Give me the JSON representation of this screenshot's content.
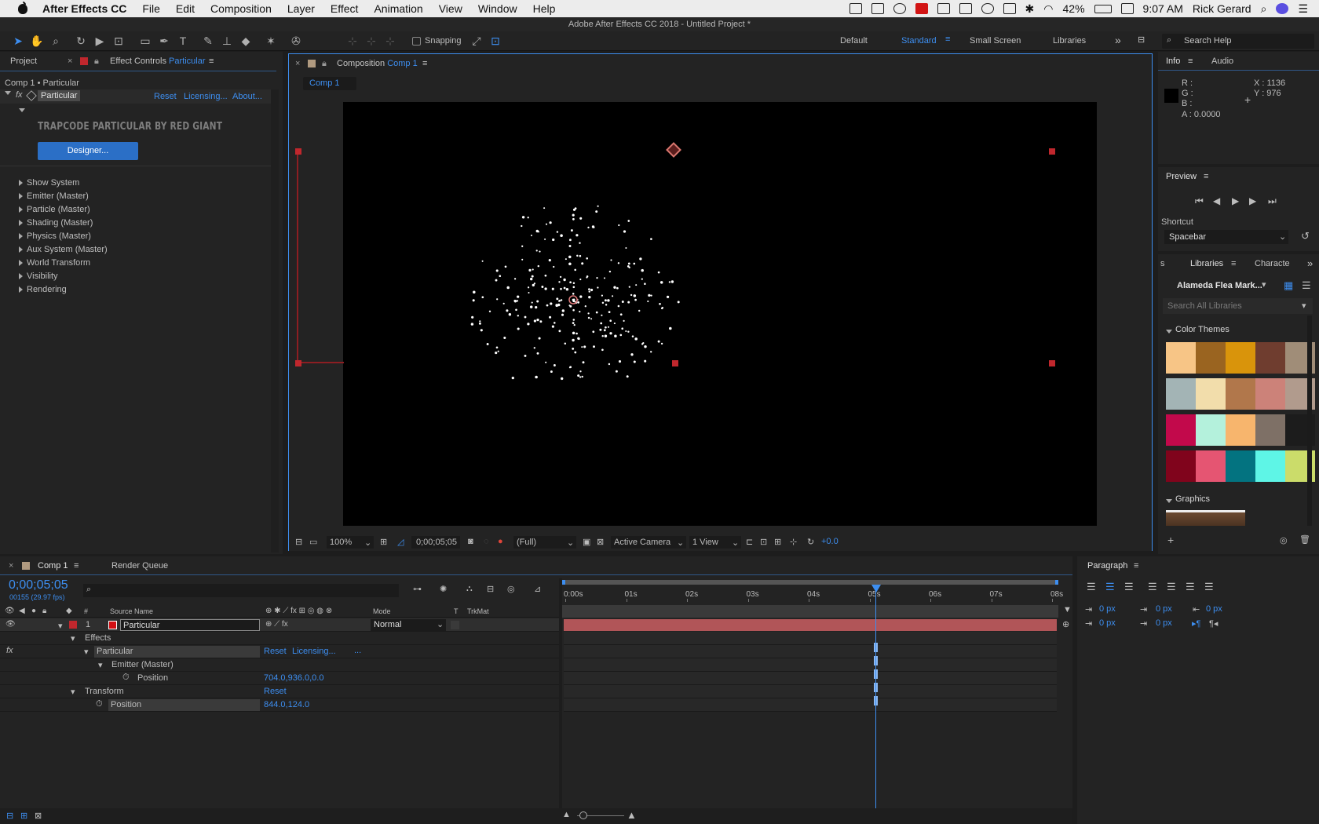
{
  "macbar": {
    "app": "After Effects CC",
    "menus": [
      "File",
      "Edit",
      "Composition",
      "Layer",
      "Effect",
      "Animation",
      "View",
      "Window",
      "Help"
    ],
    "battery": "42%",
    "time": "9:07 AM",
    "user": "Rick Gerard"
  },
  "window_title": "Adobe After Effects CC 2018 - Untitled Project *",
  "toolbar": {
    "snapping": "Snapping",
    "workspaces": [
      "Default",
      "Standard",
      "Small Screen",
      "Libraries"
    ],
    "active_workspace": "Standard",
    "search": "Search Help"
  },
  "left_panel": {
    "tab_project": "Project",
    "tab_effect_prefix": "Effect Controls",
    "tab_effect_layer": "Particular",
    "breadcrumb": "Comp 1 • Particular",
    "effect_name": "Particular",
    "reset": "Reset",
    "licensing": "Licensing...",
    "about": "About...",
    "brand": "TRAPCODE PARTICULAR BY RED GIANT",
    "designer": "Designer...",
    "groups": [
      "Show System",
      "Emitter (Master)",
      "Particle (Master)",
      "Shading (Master)",
      "Physics (Master)",
      "Aux System (Master)",
      "World Transform",
      "Visibility",
      "Rendering"
    ]
  },
  "comp_panel": {
    "tab_prefix": "Composition",
    "tab_name": "Comp 1",
    "subtab": "Comp 1",
    "zoom": "100%",
    "timecode": "0;00;05;05",
    "resolution": "(Full)",
    "camera": "Active Camera",
    "views": "1 View",
    "exposure": "+0.0"
  },
  "info": {
    "tab_info": "Info",
    "tab_audio": "Audio",
    "r": "R :",
    "g": "G :",
    "b": "B :",
    "a": "A : 0.0000",
    "x": "X : 1136",
    "y": "Y : 976"
  },
  "preview": {
    "title": "Preview",
    "shortcut_label": "Shortcut",
    "shortcut_value": "Spacebar"
  },
  "libraries": {
    "tab_libraries": "Libraries",
    "tab_character": "Characte",
    "library_name": "Alameda Flea Mark...",
    "search_placeholder": "Search All Libraries",
    "color_themes": "Color Themes",
    "graphics": "Graphics",
    "themes": [
      [
        "#f7c586",
        "#9a6420",
        "#d9940b",
        "#6f3d2f",
        "#a08d78"
      ],
      [
        "#a3b4b5",
        "#f2ddab",
        "#b1774b",
        "#cc8279",
        "#b19b8d"
      ],
      [
        "#c2094b",
        "#b4f1dc",
        "#f7b56d",
        "#7e7066",
        "#1c1c1c"
      ],
      [
        "#80041c",
        "#e55572",
        "#037380",
        "#5ef5e6",
        "#cbdc6a"
      ]
    ]
  },
  "timeline": {
    "tab_comp": "Comp 1",
    "tab_render": "Render Queue",
    "timecode": "0;00;05;05",
    "frames": "00155 (29.97 fps)",
    "col_source": "Source Name",
    "col_mode": "Mode",
    "col_t": "T",
    "col_trkmat": "TrkMat",
    "layer_num": "1",
    "layer_name": "Particular",
    "layer_mode": "Normal",
    "effects": "Effects",
    "effect": "Particular",
    "effect_reset": "Reset",
    "effect_licensing": "Licensing...",
    "effect_more": "...",
    "emitter": "Emitter (Master)",
    "position": "Position",
    "emitter_position_value": "704.0,936.0,0.0",
    "transform": "Transform",
    "transform_reset": "Reset",
    "transform_position": "Position",
    "transform_position_value": "844.0,124.0",
    "ruler": [
      "0:00s",
      "01s",
      "02s",
      "03s",
      "04s",
      "05s",
      "06s",
      "07s",
      "08s"
    ],
    "playhead_fraction": 0.639
  },
  "paragraph": {
    "title": "Paragraph",
    "fields": [
      "0 px",
      "0 px",
      "0 px",
      "0 px",
      "0 px"
    ]
  }
}
